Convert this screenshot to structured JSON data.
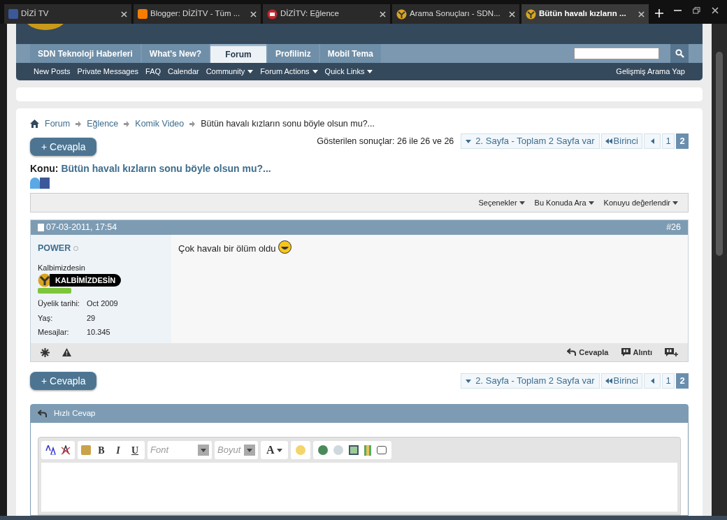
{
  "browser_tabs": [
    {
      "label": "DİZİ TV",
      "kind": "facebook",
      "selected": false
    },
    {
      "label": "Blogger: DİZİTV - Tüm ...",
      "kind": "blogger",
      "selected": false
    },
    {
      "label": "DİZİTV: Eğlence",
      "kind": "tv",
      "selected": false
    },
    {
      "label": "Arama Sonuçları - SDN...",
      "kind": "sdn",
      "selected": false
    },
    {
      "label": "Bütün havalı kızların ...",
      "kind": "sdn",
      "selected": true
    }
  ],
  "navbar": {
    "tabs": [
      {
        "label": "SDN Teknoloji Haberleri",
        "selected": false
      },
      {
        "label": "What's New?",
        "selected": false
      },
      {
        "label": "Forum",
        "selected": true
      },
      {
        "label": "Profiliniz",
        "selected": false
      },
      {
        "label": "Mobil Tema",
        "selected": false
      }
    ],
    "links": [
      {
        "label": "New Posts",
        "dropdown": false
      },
      {
        "label": "Private Messages",
        "dropdown": false
      },
      {
        "label": "FAQ",
        "dropdown": false
      },
      {
        "label": "Calendar",
        "dropdown": false
      },
      {
        "label": "Community",
        "dropdown": true
      },
      {
        "label": "Forum Actions",
        "dropdown": true
      },
      {
        "label": "Quick Links",
        "dropdown": true
      }
    ],
    "advanced_search": "Gelişmiş Arama Yap"
  },
  "breadcrumb": {
    "links": [
      "Forum",
      "Eğlence",
      "Komik Video"
    ],
    "current": "Bütün havalı kızların sonu böyle olsun mu?..."
  },
  "reply_button": "+ Cevapla",
  "results": "Gösterilen sonuçlar: 26 ile 26 ve 26",
  "pagination": {
    "jump": "2. Sayfa - Toplam 2 Sayfa var",
    "first": "Birinci",
    "pages": [
      {
        "label": "1",
        "selected": false
      },
      {
        "label": "2",
        "selected": true
      }
    ]
  },
  "thread": {
    "prefix": "Konu:",
    "title": "Bütün havalı kızların sonu böyle olsun mu?..."
  },
  "thread_tools": [
    "Seçenekler",
    "Bu Konuda Ara",
    "Konuyu değerlendir"
  ],
  "post": {
    "date": "07-03-2011, 17:54",
    "number": "#26",
    "user": {
      "name": "POWER",
      "online": false,
      "title": "Kalbimizdesin",
      "rank": "KALBİMİZDESİN",
      "stats": [
        {
          "label": "Üyelik tarihi:",
          "value": "Oct 2009"
        },
        {
          "label": "Yaş:",
          "value": "29"
        },
        {
          "label": "Mesajlar:",
          "value": "10.345"
        }
      ]
    },
    "message": "Çok havalı bir ölüm oldu",
    "actions": [
      "Cevapla",
      "Alıntı"
    ]
  },
  "reply_button_bottom": "+ Cevapla",
  "pagination_bottom": {
    "jump": "2. Sayfa - Toplam 2 Sayfa var",
    "first": "Birinci",
    "pages": [
      {
        "label": "1",
        "selected": false
      },
      {
        "label": "2",
        "selected": true
      }
    ]
  },
  "quick_reply": {
    "title": "Hızlı Cevap",
    "format_buttons": [
      "B",
      "I",
      "U"
    ],
    "font_placeholder": "Font",
    "size_placeholder": "Boyut",
    "color_button": "A"
  }
}
